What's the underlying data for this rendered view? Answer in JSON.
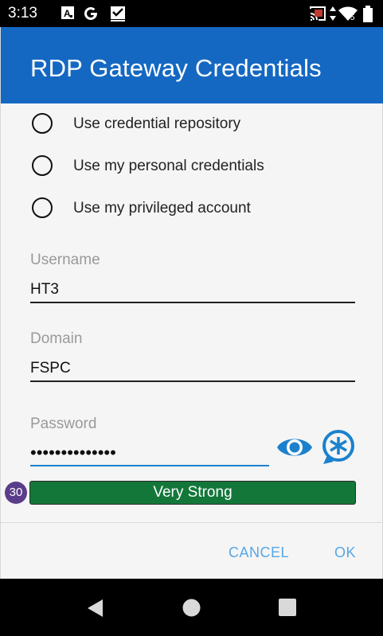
{
  "status_bar": {
    "time": "3:13",
    "icons": [
      "text-notification-icon",
      "google-icon",
      "checkbox-notification-icon",
      "cast-icon",
      "data-arrows-icon",
      "wifi-icon",
      "battery-icon"
    ],
    "wifi_badge": "5"
  },
  "dialog": {
    "title": "RDP Gateway Credentials",
    "header_color": "#1468c2",
    "options": [
      {
        "label": "Use credential repository",
        "selected": false
      },
      {
        "label": "Use my personal credentials",
        "selected": false
      },
      {
        "label": "Use my privileged account",
        "selected": false
      }
    ],
    "username": {
      "label": "Username",
      "value": "HT3"
    },
    "domain": {
      "label": "Domain",
      "value": "FSPC"
    },
    "password": {
      "label": "Password",
      "value": "••••••••••••••"
    },
    "strength": {
      "badge": "30",
      "label": "Very Strong",
      "color": "#13773a"
    },
    "buttons": {
      "cancel": "CANCEL",
      "ok": "OK"
    },
    "accent_color": "#1b81cc"
  },
  "nav_bar": {
    "icons": [
      "back-icon",
      "home-icon",
      "recents-icon"
    ]
  }
}
